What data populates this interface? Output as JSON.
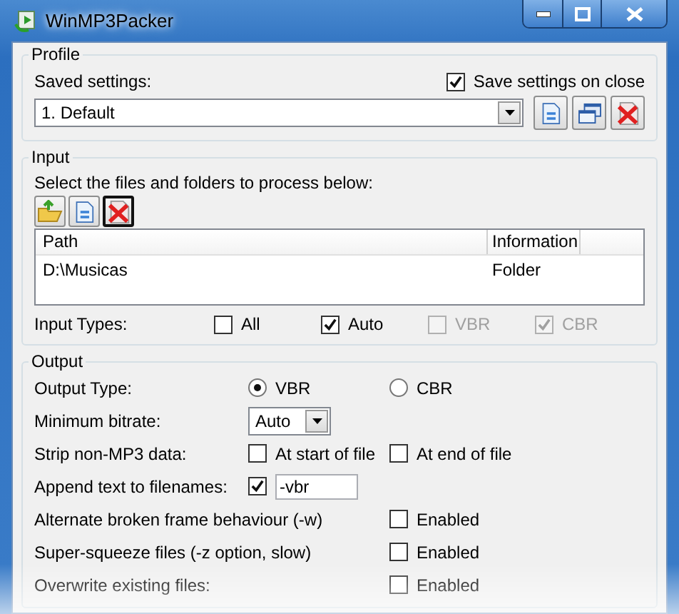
{
  "window": {
    "title": "WinMP3Packer"
  },
  "profile": {
    "title": "Profile",
    "saved_label": "Saved settings:",
    "save_on_close": {
      "label": "Save settings on close",
      "checked": true
    },
    "selected_profile": "1. Default",
    "buttons": [
      {
        "kind": "new"
      },
      {
        "kind": "copy"
      },
      {
        "kind": "delete"
      }
    ]
  },
  "input": {
    "title": "Input",
    "instruction": "Select the files and folders to process below:",
    "toolbar": [
      {
        "kind": "add-folder",
        "focused": false
      },
      {
        "kind": "add-file",
        "focused": false
      },
      {
        "kind": "delete",
        "focused": true
      }
    ],
    "columns": [
      "Path",
      "Information"
    ],
    "rows": [
      {
        "path": "D:\\Musicas",
        "information": "Folder"
      }
    ],
    "types_label": "Input Types:",
    "types": [
      {
        "label": "All",
        "checked": false,
        "disabled": false
      },
      {
        "label": "Auto",
        "checked": true,
        "disabled": false
      },
      {
        "label": "VBR",
        "checked": false,
        "disabled": true
      },
      {
        "label": "CBR",
        "checked": true,
        "disabled": true
      }
    ]
  },
  "output": {
    "title": "Output",
    "rows": [
      {
        "kind": "radio",
        "label": "Output Type:",
        "options": [
          {
            "label": "VBR",
            "selected": true
          },
          {
            "label": "CBR",
            "selected": false
          }
        ]
      },
      {
        "kind": "select",
        "label": "Minimum bitrate:",
        "value": "Auto"
      },
      {
        "kind": "checks",
        "label": "Strip non-MP3 data:",
        "options": [
          {
            "label": "At start of file",
            "checked": false
          },
          {
            "label": "At end of file",
            "checked": false
          }
        ]
      },
      {
        "kind": "check_text",
        "label": "Append text to filenames:",
        "checked": true,
        "value": "-vbr"
      },
      {
        "kind": "checks",
        "label": "Alternate broken frame behaviour (-w)",
        "options": [
          {
            "label": "Enabled",
            "checked": false
          }
        ]
      },
      {
        "kind": "checks",
        "label": "Super-squeeze files (-z option, slow)",
        "options": [
          {
            "label": "Enabled",
            "checked": false
          }
        ]
      },
      {
        "kind": "checks",
        "label": "Overwrite existing files:",
        "options": [
          {
            "label": "Enabled",
            "checked": false
          }
        ]
      }
    ]
  }
}
